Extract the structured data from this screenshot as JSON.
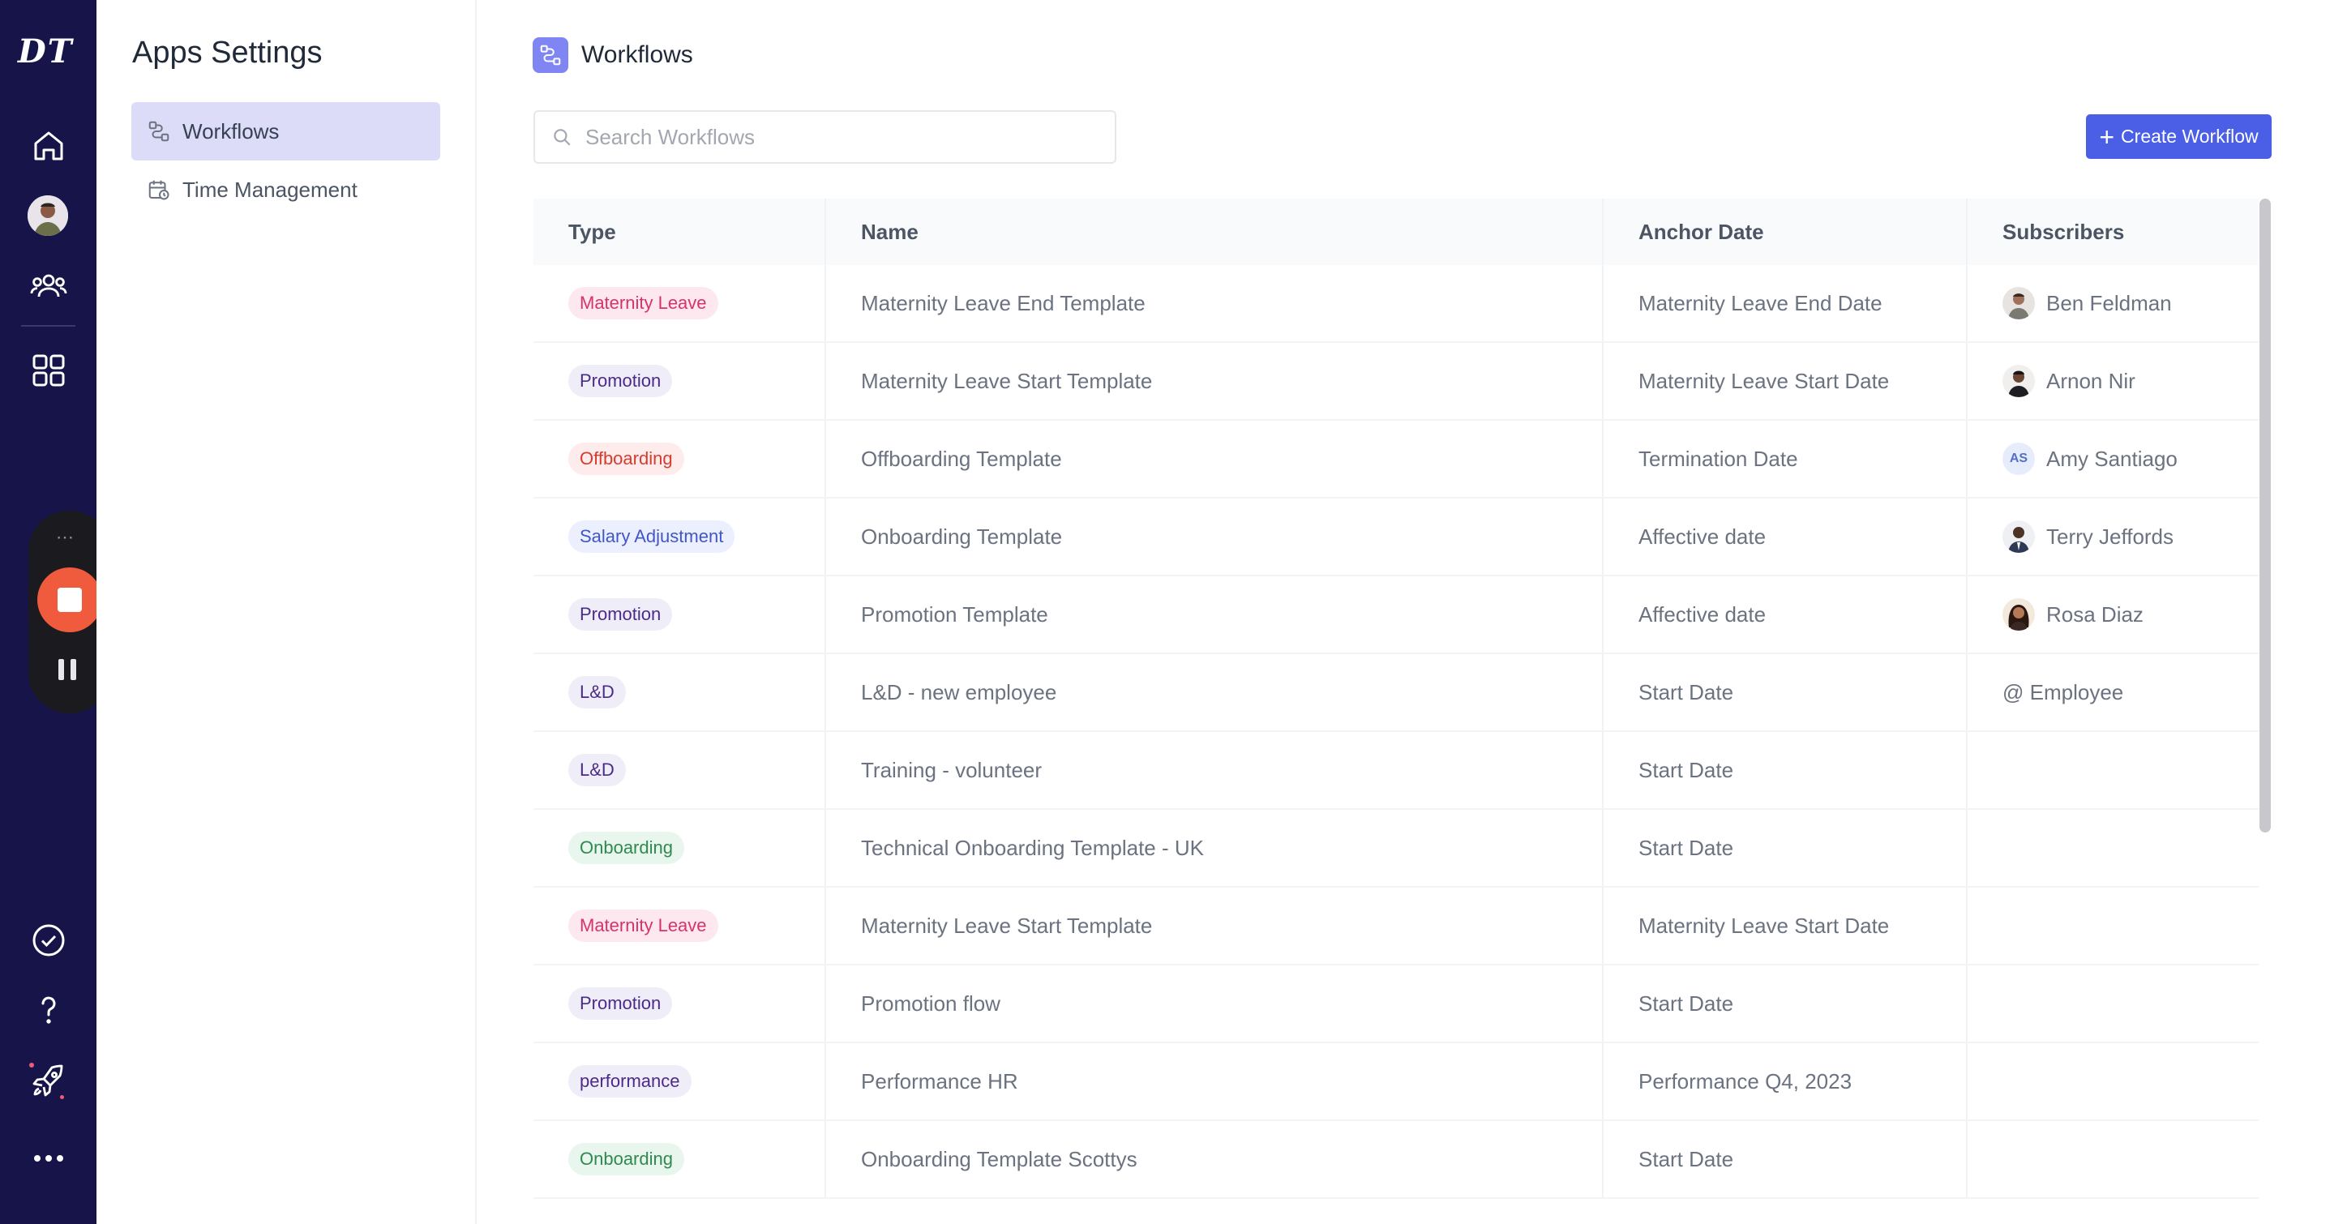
{
  "app": {
    "logo": "DT"
  },
  "nav": {
    "items": [
      "home-icon",
      "profile-avatar",
      "people-icon",
      "apps-grid-icon",
      "check-circle-icon",
      "help-icon",
      "rocket-icon",
      "more-icon"
    ]
  },
  "recorder": {
    "grip": "⋯",
    "controls": [
      "stop-icon",
      "pause-icon"
    ]
  },
  "settings": {
    "title": "Apps Settings",
    "items": [
      {
        "label": "Workflows",
        "icon": "workflow-icon",
        "active": true
      },
      {
        "label": "Time Management",
        "icon": "calendar-clock-icon",
        "active": false
      }
    ]
  },
  "header": {
    "title": "Workflows",
    "icon": "workflow-icon"
  },
  "search": {
    "placeholder": "Search Workflows",
    "value": ""
  },
  "create_button": {
    "label": "Create Workflow",
    "icon": "plus-icon"
  },
  "table": {
    "columns": [
      "Type",
      "Name",
      "Anchor Date",
      "Subscribers"
    ],
    "rows": [
      {
        "type": "Maternity Leave",
        "name": "Maternity Leave End Template",
        "anchor": "Maternity Leave End Date",
        "subscriber": "Ben Feldman",
        "sub_kind": "photo"
      },
      {
        "type": "Promotion",
        "name": "Maternity Leave Start Template",
        "anchor": "Maternity Leave Start Date",
        "subscriber": "Arnon Nir",
        "sub_kind": "photo"
      },
      {
        "type": "Offboarding",
        "name": "Offboarding Template",
        "anchor": "Termination Date",
        "subscriber": "Amy Santiago",
        "sub_kind": "initials",
        "initials": "AS"
      },
      {
        "type": "Salary Adjustment",
        "name": "Onboarding Template",
        "anchor": "Affective date",
        "subscriber": "Terry Jeffords",
        "sub_kind": "photo"
      },
      {
        "type": "Promotion",
        "name": "Promotion Template",
        "anchor": "Affective date",
        "subscriber": "Rosa Diaz",
        "sub_kind": "photo"
      },
      {
        "type": "L&D",
        "name": "L&D - new employee",
        "anchor": "Start Date",
        "subscriber": "@ Employee",
        "sub_kind": "text"
      },
      {
        "type": "L&D",
        "name": "Training - volunteer",
        "anchor": "Start Date",
        "subscriber": "",
        "sub_kind": "none"
      },
      {
        "type": "Onboarding",
        "name": "Technical Onboarding Template - UK",
        "anchor": "Start Date",
        "subscriber": "",
        "sub_kind": "none"
      },
      {
        "type": "Maternity Leave",
        "name": "Maternity Leave Start Template",
        "anchor": "Maternity Leave Start Date",
        "subscriber": "",
        "sub_kind": "none"
      },
      {
        "type": "Promotion",
        "name": "Promotion flow",
        "anchor": "Start Date",
        "subscriber": "",
        "sub_kind": "none"
      },
      {
        "type": "performance",
        "name": "Performance HR",
        "anchor": "Performance Q4, 2023",
        "subscriber": "",
        "sub_kind": "none"
      },
      {
        "type": "Onboarding",
        "name": "Onboarding Template Scottys",
        "anchor": "Start Date",
        "subscriber": "",
        "sub_kind": "none"
      }
    ]
  },
  "tag_colors": {
    "Maternity Leave": {
      "bg": "#fde8ef",
      "fg": "#d6336c"
    },
    "Promotion": {
      "bg": "#efedf8",
      "fg": "#4c2a8a"
    },
    "Offboarding": {
      "bg": "#fdeceb",
      "fg": "#d63c2e"
    },
    "Salary Adjustment": {
      "bg": "#eceffd",
      "fg": "#4057c9"
    },
    "L&D": {
      "bg": "#efedf8",
      "fg": "#4c2a8a"
    },
    "Onboarding": {
      "bg": "#e8f6ee",
      "fg": "#2f8a4f"
    },
    "performance": {
      "bg": "#efedf8",
      "fg": "#4c2a8a"
    }
  },
  "colors": {
    "rail": "#17144a",
    "accent": "#4a5ee6",
    "active_item": "#dcdcf9",
    "record": "#ef5b3c"
  }
}
